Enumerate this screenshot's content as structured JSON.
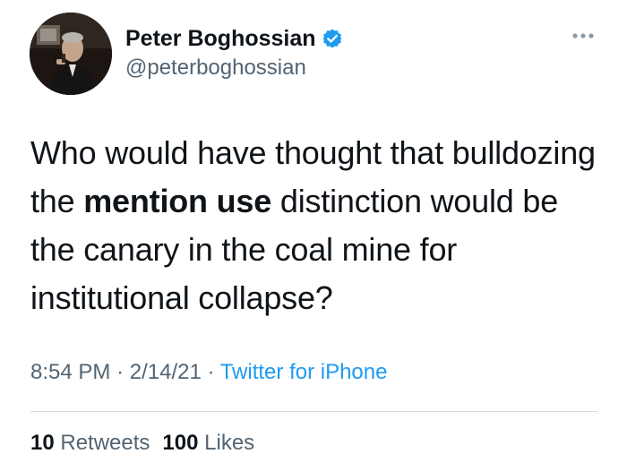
{
  "author": {
    "display_name": "Peter Boghossian",
    "handle": "@peterboghossian",
    "verified": true,
    "verified_color": "#1d9bf0"
  },
  "tweet": {
    "text_before": "Who would have thought that bulldozing the ",
    "text_bold": "mention use",
    "text_after": " distinction would be the canary in the coal mine for institutional collapse?"
  },
  "meta": {
    "time": "8:54 PM",
    "date": "2/14/21",
    "separator": "·",
    "source": "Twitter for iPhone",
    "source_color": "#1d9bf0"
  },
  "stats": {
    "retweets_count": "10",
    "retweets_label": "Retweets",
    "likes_count": "100",
    "likes_label": "Likes"
  },
  "icons": {
    "verified": "verified-badge-icon",
    "more": "more-options-icon"
  }
}
